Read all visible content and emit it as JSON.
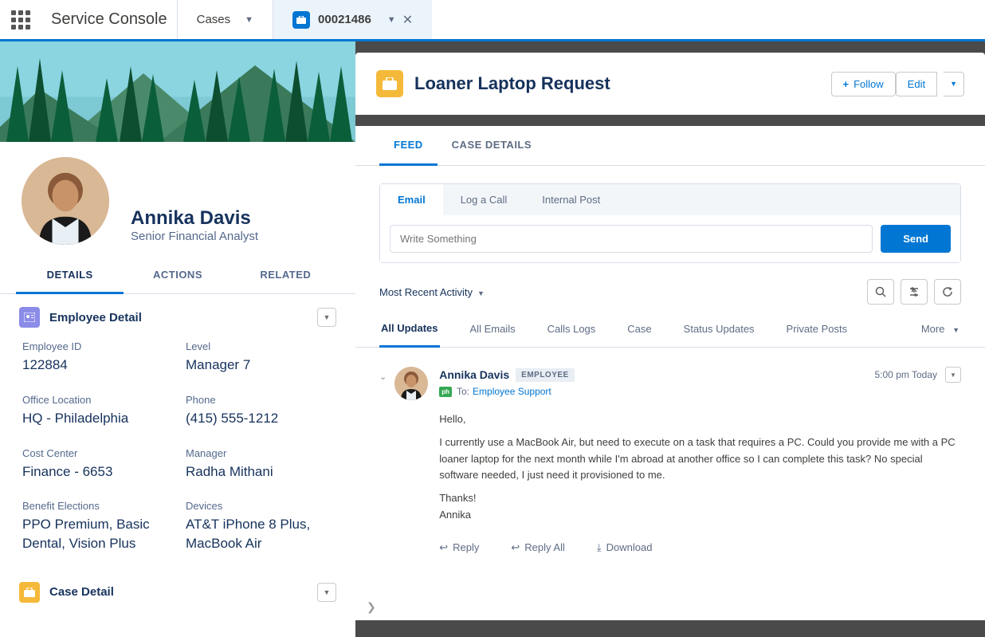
{
  "header": {
    "app_name": "Service Console",
    "nav_item": "Cases",
    "tab_number": "00021486"
  },
  "profile": {
    "name": "Annika Davis",
    "title": "Senior Financial Analyst",
    "tabs": [
      "DETAILS",
      "ACTIONS",
      "RELATED"
    ]
  },
  "employee": {
    "section_title": "Employee Detail",
    "id_label": "Employee ID",
    "id_value": "122884",
    "level_label": "Level",
    "level_value": "Manager 7",
    "office_label": "Office Location",
    "office_value": "HQ - Philadelphia",
    "phone_label": "Phone",
    "phone_value": "(415) 555-1212",
    "cost_label": "Cost Center",
    "cost_value": "Finance - 6653",
    "mgr_label": "Manager",
    "mgr_value": "Radha Mithani",
    "benefit_label": "Benefit Elections",
    "benefit_value": "PPO Premium, Basic Dental, Vision Plus",
    "devices_label": "Devices",
    "devices_value": "AT&T iPhone 8 Plus, MacBook Air"
  },
  "case_detail": {
    "section_title": "Case Detail"
  },
  "case": {
    "title": "Loaner Laptop Request",
    "follow": "Follow",
    "edit": "Edit",
    "tabs": [
      "FEED",
      "CASE DETAILS"
    ],
    "composer_tabs": [
      "Email",
      "Log a Call",
      "Internal Post"
    ],
    "composer_placeholder": "Write Something",
    "send": "Send",
    "filter": "Most Recent Activity",
    "filter_tabs": [
      "All Updates",
      "All Emails",
      "Calls Logs",
      "Case",
      "Status Updates",
      "Private Posts",
      "More"
    ]
  },
  "feed": {
    "name": "Annika Davis",
    "badge": "EMPLOYEE",
    "time": "5:00 pm Today",
    "to_label": "To:",
    "to_link": "Employee Support",
    "greeting": "Hello,",
    "para1": "I currently use a MacBook Air, but need to execute on a task that requires a PC.  Could you provide me with a PC loaner laptop for the next month while I'm abroad at another office so I can complete this task? No special software needed, I just need it provisioned to me.",
    "closing1": "Thanks!",
    "closing2": "Annika",
    "actions": {
      "reply": "Reply",
      "reply_all": "Reply All",
      "download": "Download"
    }
  },
  "icons": {
    "phone_badge": "ph"
  }
}
